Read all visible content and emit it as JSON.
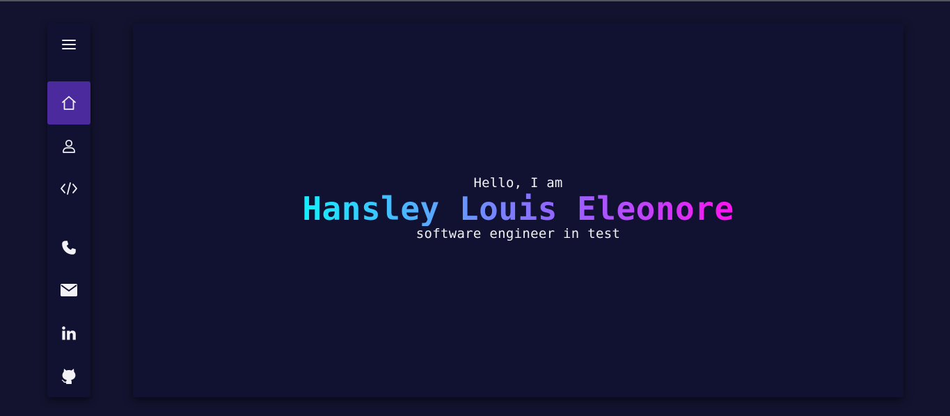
{
  "sidebar": {
    "items": [
      {
        "icon": "hamburger-menu-icon"
      },
      {
        "icon": "home-icon",
        "active": true
      },
      {
        "icon": "user-icon"
      },
      {
        "icon": "code-icon"
      },
      {
        "icon": "phone-icon"
      },
      {
        "icon": "envelope-icon"
      },
      {
        "icon": "linkedin-icon"
      },
      {
        "icon": "github-icon"
      }
    ],
    "active_color": "#4b2a9d"
  },
  "hero": {
    "greeting": "Hello, I am",
    "name": "Hansley Louis Eleonore",
    "role": "software engineer in test",
    "gradient_colors": [
      "#11f0ff",
      "#ff12ee"
    ]
  },
  "colors": {
    "background": "#13132f",
    "card": "#111132",
    "text": "#f1f1f5"
  }
}
